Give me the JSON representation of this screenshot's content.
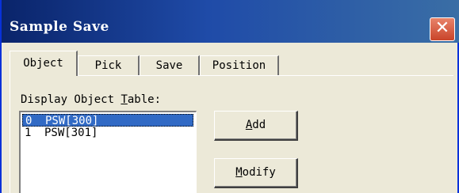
{
  "window": {
    "title": "Sample Save",
    "close_symbol": "✕"
  },
  "tabs": [
    {
      "label": "Object",
      "active": true
    },
    {
      "label": "Pick",
      "active": false
    },
    {
      "label": "Save",
      "active": false
    },
    {
      "label": "Position",
      "active": false
    }
  ],
  "object_tab": {
    "table_label_before": "Display Object ",
    "table_label_accel": "T",
    "table_label_after": "able:",
    "list": [
      {
        "index": "0",
        "name": "PSW[300]",
        "selected": true
      },
      {
        "index": "1",
        "name": "PSW[301]",
        "selected": false
      }
    ],
    "add_button": {
      "accel": "A",
      "rest": "dd"
    },
    "modify_button": {
      "accel": "M",
      "rest": "odify"
    }
  },
  "colors": {
    "title_start": "#0a246a",
    "title_end": "#3a6ea5",
    "selection": "#316ac5",
    "close": "#c9442a"
  }
}
